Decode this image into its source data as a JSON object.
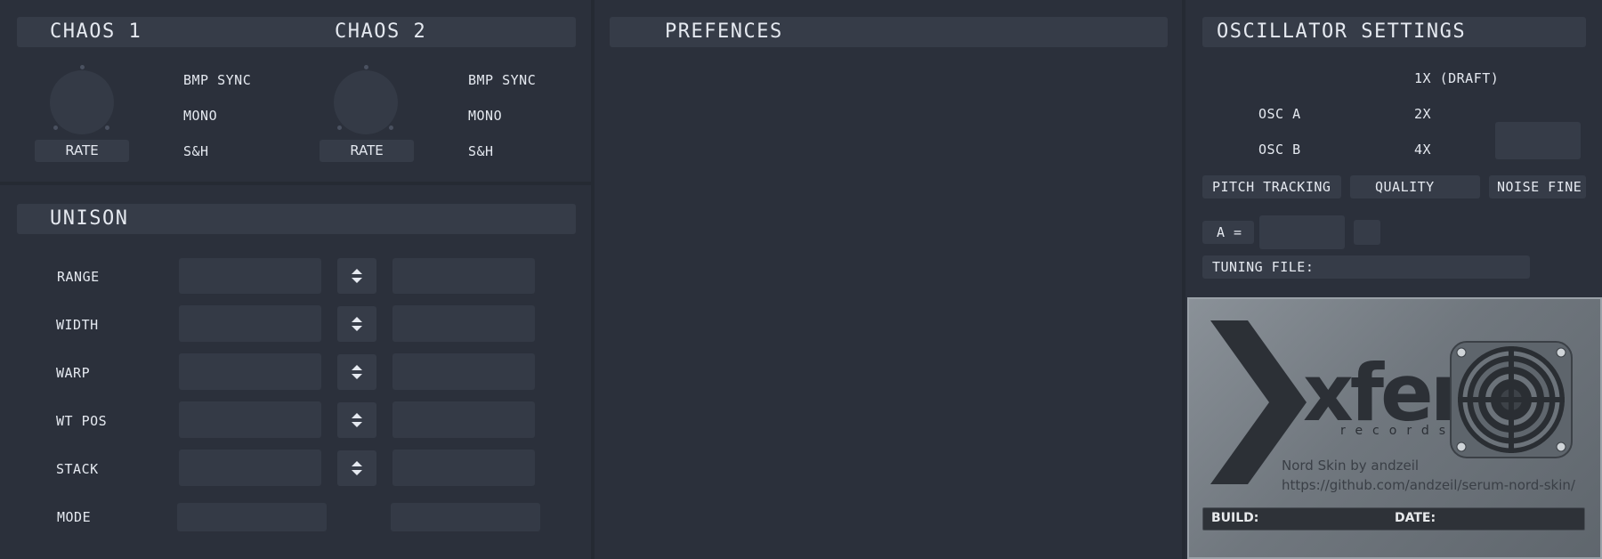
{
  "chaos1": {
    "title": "CHAOS 1",
    "rate_label": "RATE",
    "bpm_sync": "BMP SYNC",
    "mono": "MONO",
    "sh": "S&H"
  },
  "chaos2": {
    "title": "CHAOS 2",
    "rate_label": "RATE",
    "bpm_sync": "BMP SYNC",
    "mono": "MONO",
    "sh": "S&H"
  },
  "unison": {
    "title": "UNISON",
    "rows": [
      {
        "label": "RANGE"
      },
      {
        "label": "WIDTH"
      },
      {
        "label": "WARP"
      },
      {
        "label": "WT POS"
      },
      {
        "label": "STACK"
      }
    ],
    "mode_label": "MODE"
  },
  "preferences": {
    "title": "PREFENCES"
  },
  "oscillator_settings": {
    "title": "OSCILLATOR SETTINGS",
    "quality_draft": "1X (DRAFT)",
    "quality_2x": "2X",
    "quality_4x": "4X",
    "osc_a": "OSC A",
    "osc_b": "OSC B",
    "pitch_tracking": "PITCH TRACKING",
    "quality": "QUALITY",
    "noise_fine": "NOISE FINE",
    "a_equals": "A =",
    "tuning_file": "TUNING FILE:"
  },
  "about": {
    "logo_text": "xfer",
    "logo_subtext": "records",
    "skin_credit": "Nord Skin by andzeil",
    "skin_url": "https://github.com/andzeil/serum-nord-skin/",
    "build_label": "BUILD:",
    "date_label": "DATE:"
  },
  "colors": {
    "background": "#2b303b",
    "panel": "#363c48",
    "field": "#343a46",
    "text": "#e5e9f0"
  },
  "icons": {
    "spinner": "up-down-arrows-icon",
    "speaker": "speaker-grille-icon",
    "logo": "xfer-chevron-icon"
  }
}
